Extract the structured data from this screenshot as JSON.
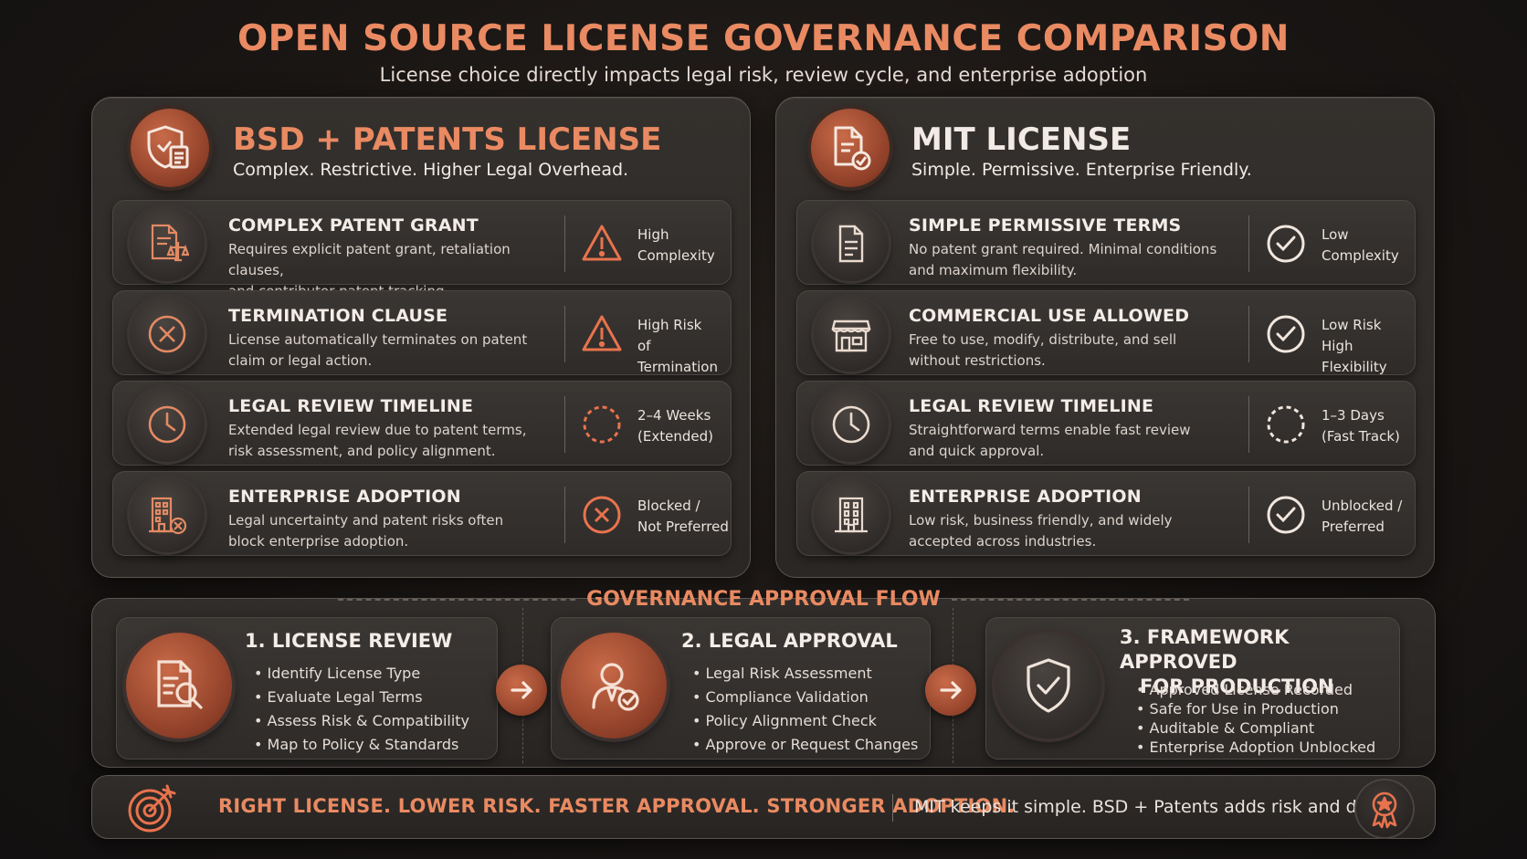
{
  "header": {
    "title": "OPEN SOURCE LICENSE GOVERNANCE COMPARISON",
    "subtitle": "License choice directly impacts legal risk, review cycle, and enterprise adoption"
  },
  "bsd": {
    "title": "BSD + PATENTS LICENSE",
    "subtitle": "Complex. Restrictive. Higher Legal Overhead.",
    "rows": [
      {
        "title": "COMPLEX PATENT GRANT",
        "desc1": "Requires explicit patent grant, retaliation clauses,",
        "desc2": "and contributor patent tracking.",
        "status1": "High",
        "status2": "Complexity"
      },
      {
        "title": "TERMINATION CLAUSE",
        "desc1": "License automatically terminates on patent",
        "desc2": "claim or legal action.",
        "status1": "High Risk",
        "status2": "of Termination"
      },
      {
        "title": "LEGAL REVIEW TIMELINE",
        "desc1": "Extended legal review due to patent terms,",
        "desc2": "risk assessment, and policy alignment.",
        "status1": "2–4 Weeks",
        "status2": "(Extended)"
      },
      {
        "title": "ENTERPRISE ADOPTION",
        "desc1": "Legal uncertainty and patent risks often",
        "desc2": "block enterprise adoption.",
        "status1": "Blocked /",
        "status2": "Not Preferred"
      }
    ]
  },
  "mit": {
    "title": "MIT LICENSE",
    "subtitle": "Simple. Permissive. Enterprise Friendly.",
    "rows": [
      {
        "title": "SIMPLE PERMISSIVE TERMS",
        "desc1": "No patent grant required. Minimal conditions",
        "desc2": "and maximum flexibility.",
        "status1": "Low",
        "status2": "Complexity"
      },
      {
        "title": "COMMERCIAL USE ALLOWED",
        "desc1": "Free to use, modify, distribute, and sell",
        "desc2": "without restrictions.",
        "status1": "Low Risk",
        "status2": "High Flexibility"
      },
      {
        "title": "LEGAL REVIEW TIMELINE",
        "desc1": "Straightforward terms enable fast review",
        "desc2": "and quick approval.",
        "status1": "1–3 Days",
        "status2": "(Fast Track)"
      },
      {
        "title": "ENTERPRISE ADOPTION",
        "desc1": "Low risk, business friendly, and widely",
        "desc2": "accepted across industries.",
        "status1": "Unblocked /",
        "status2": "Preferred"
      }
    ]
  },
  "flow": {
    "label": "GOVERNANCE APPROVAL FLOW",
    "steps": [
      {
        "title": "1. LICENSE REVIEW",
        "items": [
          "Identify License Type",
          "Evaluate Legal Terms",
          "Assess Risk & Compatibility",
          "Map to Policy & Standards"
        ]
      },
      {
        "title": "2. LEGAL APPROVAL",
        "items": [
          "Legal Risk Assessment",
          "Compliance Validation",
          "Policy Alignment Check",
          "Approve or Request Changes"
        ]
      },
      {
        "title1": "3. FRAMEWORK APPROVED",
        "title2": "FOR PRODUCTION",
        "items": [
          "Approved License Recorded",
          "Safe for Use in Production",
          "Auditable & Compliant",
          "Enterprise Adoption Unblocked"
        ]
      }
    ]
  },
  "banner": {
    "main": "RIGHT LICENSE. LOWER RISK. FASTER APPROVAL. STRONGER ADOPTION.",
    "side": "MIT keeps it simple. BSD + Patents adds risk and delay."
  },
  "colors": {
    "accent": "#e98a62",
    "text": "#f2ebe5",
    "background": "#1a1614"
  }
}
